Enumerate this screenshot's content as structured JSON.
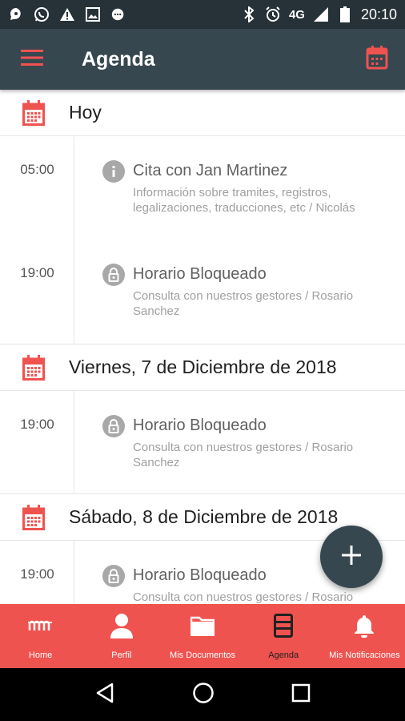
{
  "status_bar": {
    "network": "4G",
    "time": "20:10"
  },
  "app_bar": {
    "title": "Agenda",
    "menu_icon": "hamburger-menu-icon",
    "calendar_icon": "calendar-icon"
  },
  "colors": {
    "primary_dark": "#263238",
    "primary": "#37474f",
    "accent": "#ef5350",
    "event_icon": "#a8a8a8"
  },
  "days": [
    {
      "title": "Hoy",
      "events": [
        {
          "time": "05:00",
          "icon": "info-icon",
          "title": "Cita con Jan Martinez",
          "subtitle": "Información sobre tramites, registros, legalizaciones, traducciones, etc / Nicolás"
        },
        {
          "time": "19:00",
          "icon": "lock-icon",
          "title": "Horario Bloqueado",
          "subtitle": "Consulta con nuestros gestores / Rosario Sanchez"
        }
      ]
    },
    {
      "title": "Viernes, 7 de Diciembre de 2018",
      "events": [
        {
          "time": "19:00",
          "icon": "lock-icon",
          "title": "Horario Bloqueado",
          "subtitle": "Consulta con nuestros gestores / Rosario Sanchez"
        }
      ]
    },
    {
      "title": "Sábado, 8 de Diciembre de 2018",
      "events": [
        {
          "time": "19:00",
          "icon": "lock-icon",
          "title": "Horario Bloqueado",
          "subtitle": "Consulta con nuestros gestores / Rosario Sanchez"
        }
      ]
    }
  ],
  "fab": {
    "icon": "plus-icon"
  },
  "bottom_nav": [
    {
      "label": "Home",
      "icon": "logo-icon",
      "active": false
    },
    {
      "label": "Perfil",
      "icon": "user-icon",
      "active": false
    },
    {
      "label": "Mis Documentos",
      "icon": "folder-icon",
      "active": false
    },
    {
      "label": "Agenda",
      "icon": "agenda-list-icon",
      "active": true
    },
    {
      "label": "Mis Notificaciones",
      "icon": "bell-icon",
      "active": false
    }
  ]
}
